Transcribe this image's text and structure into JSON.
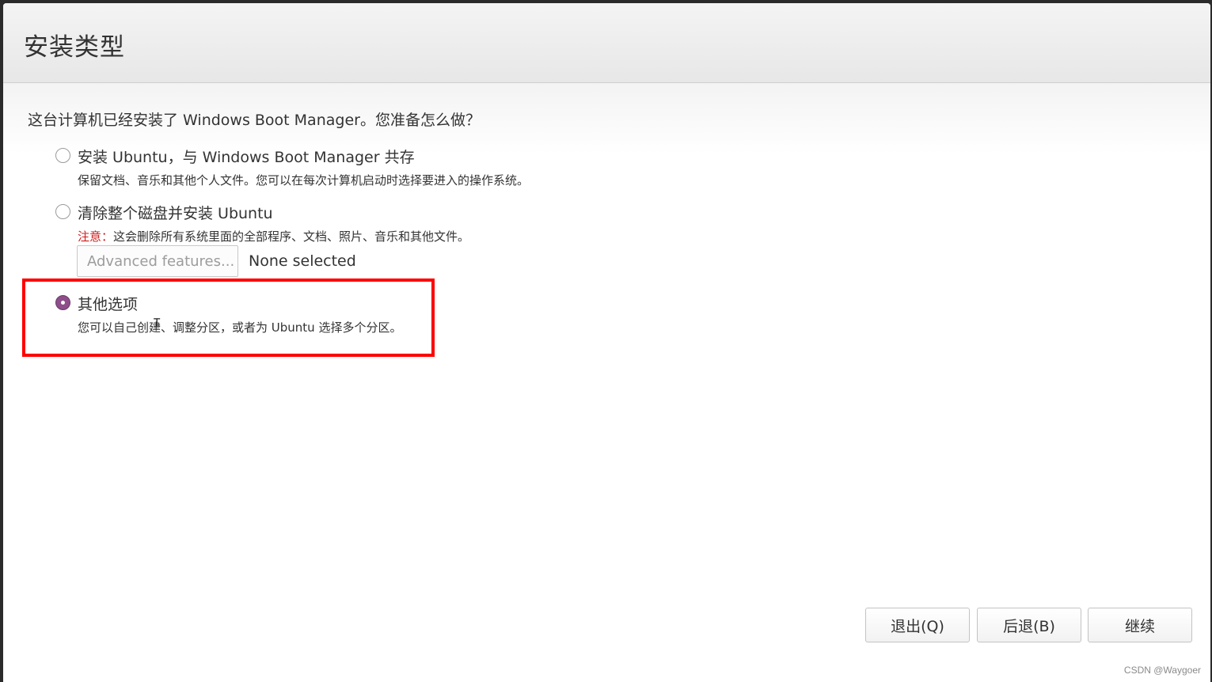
{
  "window": {
    "title": "安装类型"
  },
  "question": "这台计算机已经安装了 Windows Boot Manager。您准备怎么做？",
  "options": [
    {
      "label": "安装 Ubuntu，与 Windows Boot Manager 共存",
      "description": "保留文档、音乐和其他个人文件。您可以在每次计算机启动时选择要进入的操作系统。",
      "selected": false
    },
    {
      "label": "清除整个磁盘并安装 Ubuntu",
      "warning_prefix": "注意：",
      "description": "这会删除所有系统里面的全部程序、文档、照片、音乐和其他文件。",
      "selected": false
    },
    {
      "label": "其他选项",
      "description": "您可以自己创建、调整分区，或者为 Ubuntu 选择多个分区。",
      "selected": true
    }
  ],
  "advanced": {
    "button_label": "Advanced features...",
    "status": "None selected"
  },
  "buttons": {
    "quit": "退出(Q)",
    "back": "后退(B)",
    "continue": "继续"
  },
  "watermark": "CSDN @Waygoer",
  "colors": {
    "radio_selected": "#8d4e8a",
    "warning": "#d11a1a",
    "highlight": "#ff0000"
  }
}
